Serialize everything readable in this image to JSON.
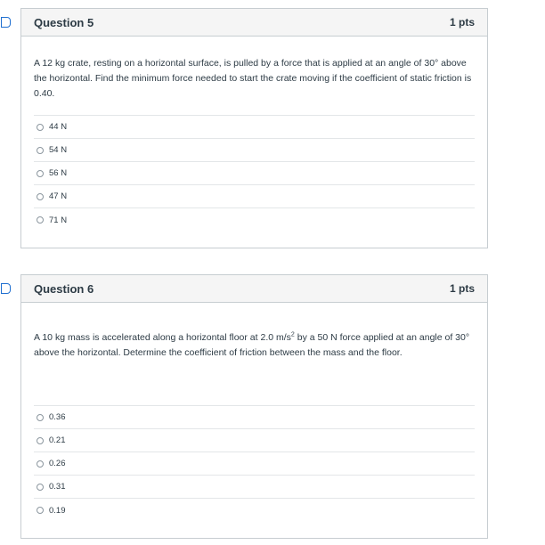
{
  "questions": [
    {
      "title": "Question 5",
      "points": "1 pts",
      "text": "A 12 kg crate, resting on a horizontal surface, is pulled by a force that is applied at an angle of 30° above the horizontal. Find the minimum force needed to start the crate moving if the coefficient of static friction is 0.40.",
      "answers": [
        "44 N",
        "54 N",
        "56 N",
        "47 N",
        "71 N"
      ]
    },
    {
      "title": "Question 6",
      "points": "1 pts",
      "text_before": "A 10 kg mass is accelerated along a horizontal floor at 2.0 m/s",
      "text_sup": "2",
      "text_after": " by a 50 N force applied at an angle of 30° above the horizontal. Determine the coefficient of friction between the mass and the floor.",
      "answers": [
        "0.36",
        "0.21",
        "0.26",
        "0.31",
        "0.19"
      ]
    }
  ],
  "icons": {
    "flag": "bookmark-flag-icon",
    "radio": "radio-circle-icon"
  },
  "colors": {
    "flag_blue": "#1f6fd0",
    "header_bg": "#f5f5f5",
    "border": "#c7cdd1",
    "text": "#2d3b45"
  }
}
